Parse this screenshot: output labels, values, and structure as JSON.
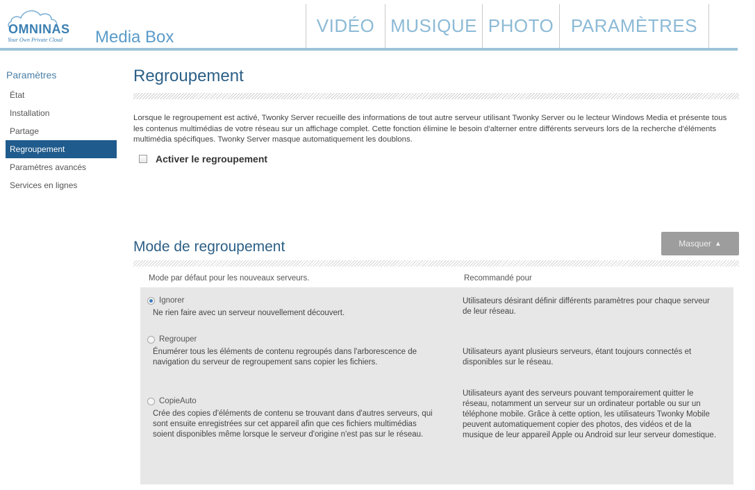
{
  "header": {
    "logo_text": "OMNINAS",
    "logo_tagline": "Your Own Private Cloud",
    "app_title": "Media Box",
    "nav_tabs": [
      "VIDÉO",
      "MUSIQUE",
      "PHOTO",
      "PARAMÈTRES"
    ]
  },
  "sidebar": {
    "heading": "Paramètres",
    "items": [
      "État",
      "Installation",
      "Partage",
      "Regroupement",
      "Paramètres avancés",
      "Services en lignes"
    ],
    "active_index": 3
  },
  "main": {
    "title": "Regroupement",
    "description": "Lorsque le regroupement est activé, Twonky Server recueille des informations de tout autre serveur utilisant Twonky Server ou le lecteur Windows Media et présente tous les contenus multimédias de votre réseau sur un affichage complet. Cette fonction élimine le besoin d'alterner entre différents serveurs lors de la recherche d'éléments multimédia spécifiques. Twonky Server masque automatiquement les doublons.",
    "checkbox_label": "Activer le regroupement",
    "checkbox_checked": false
  },
  "mode_section": {
    "title": "Mode de regroupement",
    "hide_button": "Masquer",
    "col_mode": "Mode par défaut pour les nouveaux serveurs.",
    "col_recommended": "Recommandé pour",
    "options": [
      {
        "label": "Ignorer",
        "checked": true,
        "description": "Ne rien faire avec un serveur nouvellement découvert.",
        "recommended": "Utilisateurs désirant définir différents paramètres pour chaque serveur de leur réseau."
      },
      {
        "label": "Regrouper",
        "checked": false,
        "description": "Énumérer tous les éléments de contenu regroupés dans l'arborescence de navigation du serveur de regroupement sans copier les fichiers.",
        "recommended": "Utilisateurs ayant plusieurs serveurs, étant toujours connectés et disponibles sur le réseau."
      },
      {
        "label": "CopieAuto",
        "checked": false,
        "description": "Crée des copies d'éléments de contenu se trouvant dans d'autres serveurs, qui sont ensuite enregistrées sur cet appareil afin que ces fichiers multimédias soient disponibles même lorsque le serveur d'origine n'est pas sur le réseau.",
        "recommended": "Utilisateurs ayant des serveurs pouvant temporairement quitter le réseau, notamment un serveur sur un ordinateur portable ou sur un téléphone mobile. Grâce à cette option, les utilisateurs Twonky Mobile peuvent automatiquement copier des photos, des vidéos et de la musique de leur appareil Apple ou Android sur leur serveur domestique."
      }
    ]
  },
  "colors": {
    "accent": "#1f5b8c",
    "nav_text": "#8cbad6",
    "header_rule": "#9cc3d8",
    "table_bg": "#e7e7e7",
    "button_bg": "#9d9d9d"
  }
}
